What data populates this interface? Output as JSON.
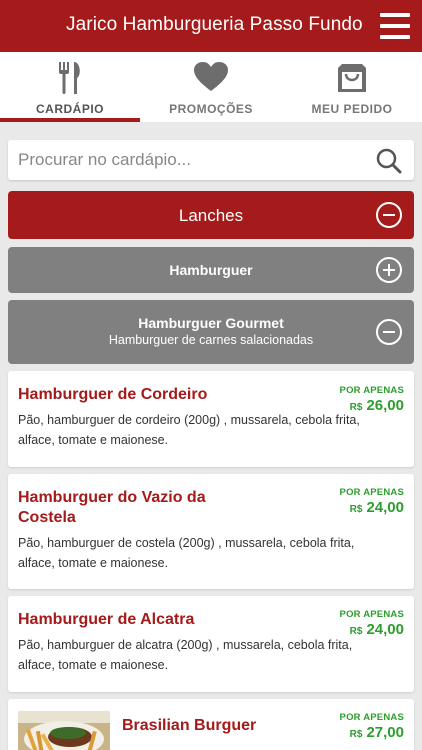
{
  "header": {
    "title": "Jarico Hamburgueria Passo Fundo",
    "menu_icon": "hamburger-menu-icon"
  },
  "tabs": [
    {
      "label": "CARDÁPIO",
      "icon": "fork-knife-icon",
      "active": true
    },
    {
      "label": "PROMOÇÕES",
      "icon": "heart-icon",
      "active": false
    },
    {
      "label": "MEU PEDIDO",
      "icon": "shopping-bag-icon",
      "active": false
    }
  ],
  "search": {
    "placeholder": "Procurar no cardápio...",
    "value": ""
  },
  "categories": [
    {
      "label": "Lanches",
      "state": "expanded",
      "icon": "minus-circle-icon"
    },
    {
      "label": "Hamburguer",
      "state": "collapsed",
      "icon": "plus-circle-icon"
    },
    {
      "label": "Hamburguer Gourmet",
      "subtitle": "Hamburguer de carnes salacionadas",
      "state": "expanded",
      "icon": "minus-circle-icon"
    }
  ],
  "items": [
    {
      "name": "Hamburguer de Cordeiro",
      "description": "Pão, hamburguer de cordeiro (200g) , mussarela, cebola frita, alface, tomate e maionese.",
      "price_label": "POR APENAS",
      "currency": "R$",
      "price": "26,00"
    },
    {
      "name": "Hamburguer do Vazio da Costela",
      "description": "Pão, hamburguer de costela (200g) , mussarela, cebola frita, alface, tomate e maionese.",
      "price_label": "POR APENAS",
      "currency": "R$",
      "price": "24,00"
    },
    {
      "name": "Hamburguer de Alcatra",
      "description": "Pão, hamburguer de alcatra (200g) , mussarela, cebola frita, alface, tomate e maionese.",
      "price_label": "POR APENAS",
      "currency": "R$",
      "price": "24,00"
    },
    {
      "name": "Brasilian Burguer",
      "description": "",
      "price_label": "POR APENAS",
      "currency": "R$",
      "price": "27,00"
    }
  ],
  "colors": {
    "brand": "#a51a1a",
    "category_gray": "#808080",
    "price_green": "#2d9e2d",
    "background": "#e9e9e9"
  }
}
